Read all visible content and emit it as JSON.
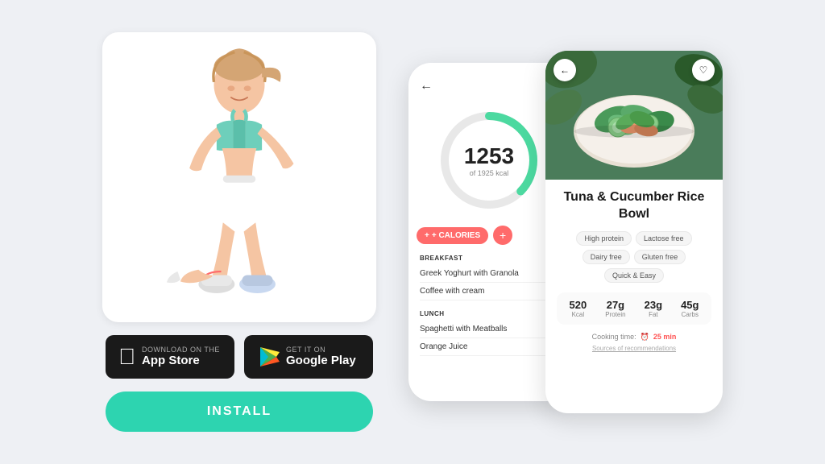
{
  "page": {
    "background_color": "#eef0f4"
  },
  "left": {
    "app_store": {
      "small_text": "Download on the",
      "large_text": "App Store"
    },
    "google_play": {
      "small_text": "GET IT ON",
      "large_text": "Google Play"
    },
    "install_button": "INSTALL"
  },
  "phone_back": {
    "calories_number": "1253",
    "calories_of": "of  1925 kcal",
    "calories_btn": "+ CALORIES",
    "breakfast_title": "BREAKFAST",
    "breakfast_items": [
      "Greek Yoghurt with Granola",
      "Coffee with cream"
    ],
    "lunch_title": "LUNCH",
    "lunch_items": [
      "Spaghetti with Meatballs",
      "Orange Juice"
    ]
  },
  "phone_front": {
    "recipe_title": "Tuna & Cucumber Rice Bowl",
    "tags": [
      "High protein",
      "Lactose free",
      "Dairy free",
      "Gluten free",
      "Quick & Easy"
    ],
    "nutrition": [
      {
        "value": "520",
        "unit": "Kcal"
      },
      {
        "value": "27g",
        "unit": "Protein"
      },
      {
        "value": "23g",
        "unit": "Fat"
      },
      {
        "value": "45g",
        "unit": "Carbs"
      }
    ],
    "cooking_time_label": "Cooking time:",
    "cooking_time_value": "25 min",
    "sources_label": "Sources of recommendations"
  }
}
